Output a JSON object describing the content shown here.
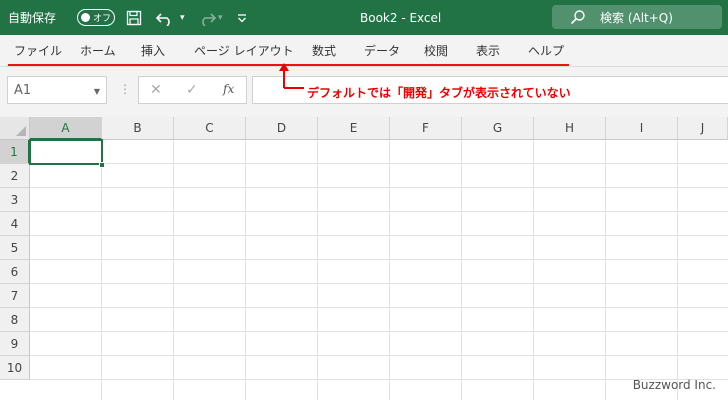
{
  "titlebar": {
    "autosave_label": "自動保存",
    "autosave_state": "オフ",
    "doc_title": "Book2  -  Excel",
    "search_label": "検索 (Alt+Q)",
    "accent_color": "#217346"
  },
  "ribbon": {
    "tabs": [
      "ファイル",
      "ホーム",
      "挿入",
      "ページ レイアウト",
      "数式",
      "データ",
      "校閲",
      "表示",
      "ヘルプ"
    ]
  },
  "formula_bar": {
    "name_box": "A1",
    "formula_value": ""
  },
  "annotation": {
    "text": "デフォルトでは「開発」タブが表示されていない",
    "color": "#ee0000"
  },
  "grid": {
    "columns": [
      "A",
      "B",
      "C",
      "D",
      "E",
      "F",
      "G",
      "H",
      "I",
      "J"
    ],
    "rows": [
      "1",
      "2",
      "3",
      "4",
      "5",
      "6",
      "7",
      "8",
      "9",
      "10"
    ],
    "active_cell": "A1"
  },
  "watermark": "Buzzword Inc."
}
